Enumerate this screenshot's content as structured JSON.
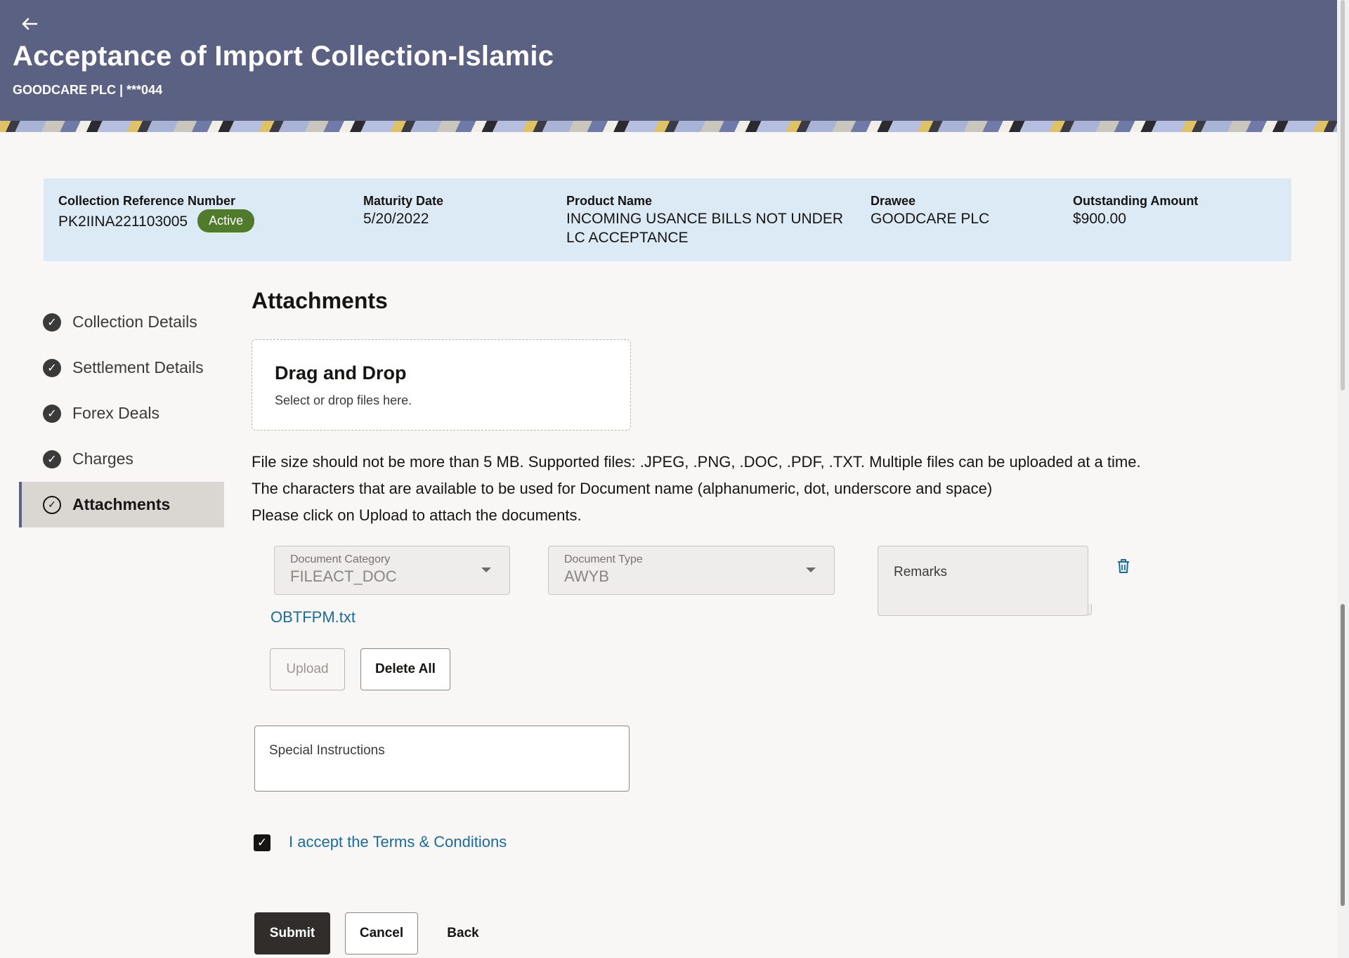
{
  "header": {
    "back_icon": "left-arrow-icon",
    "title": "Acceptance of Import Collection-Islamic",
    "subtitle": "GOODCARE PLC | ***044",
    "background_color": "#5b6183"
  },
  "summary": {
    "collection_ref_label": "Collection Reference Number",
    "collection_ref_value": "PK2IINA221103005",
    "status_badge": "Active",
    "maturity_label": "Maturity Date",
    "maturity_value": "5/20/2022",
    "product_label": "Product Name",
    "product_value": "INCOMING USANCE BILLS NOT UNDER LC ACCEPTANCE",
    "drawee_label": "Drawee",
    "drawee_value": "GOODCARE PLC",
    "outstanding_label": "Outstanding Amount",
    "outstanding_value": "$900.00"
  },
  "nav": {
    "items": [
      {
        "label": "Collection Details",
        "icon": "check-circle-icon",
        "active": false
      },
      {
        "label": "Settlement Details",
        "icon": "check-circle-icon",
        "active": false
      },
      {
        "label": "Forex Deals",
        "icon": "check-circle-icon",
        "active": false
      },
      {
        "label": "Charges",
        "icon": "check-circle-icon",
        "active": false
      },
      {
        "label": "Attachments",
        "icon": "check-circle-outline-icon",
        "active": true
      }
    ]
  },
  "main": {
    "section_title": "Attachments",
    "dropzone_title": "Drag and Drop",
    "dropzone_subtitle": "Select or drop files here.",
    "info_1": "File size should not be more than 5 MB. Supported files: .JPEG, .PNG, .DOC, .PDF, .TXT. Multiple files can be uploaded at a time.",
    "info_2": "The characters that are available to be used for Document name (alphanumeric, dot, underscore and space)",
    "info_3": "Please click on Upload to attach the documents.",
    "doc_category_label": "Document Category",
    "doc_category_value": "FILEACT_DOC",
    "doc_type_label": "Document Type",
    "doc_type_value": "AWYB",
    "remarks_label": "Remarks",
    "file_name": "OBTFPM.txt",
    "upload_label": "Upload",
    "delete_all_label": "Delete All",
    "special_instructions_label": "Special Instructions",
    "terms_label": "I accept the Terms & Conditions",
    "terms_checked": true,
    "submit_label": "Submit",
    "cancel_label": "Cancel",
    "back_label": "Back"
  },
  "colors": {
    "accent_link": "#1a6c9a",
    "badge_active": "#507b2c",
    "summary_bg": "#dbeaf4",
    "primary_button": "#312d2a"
  }
}
